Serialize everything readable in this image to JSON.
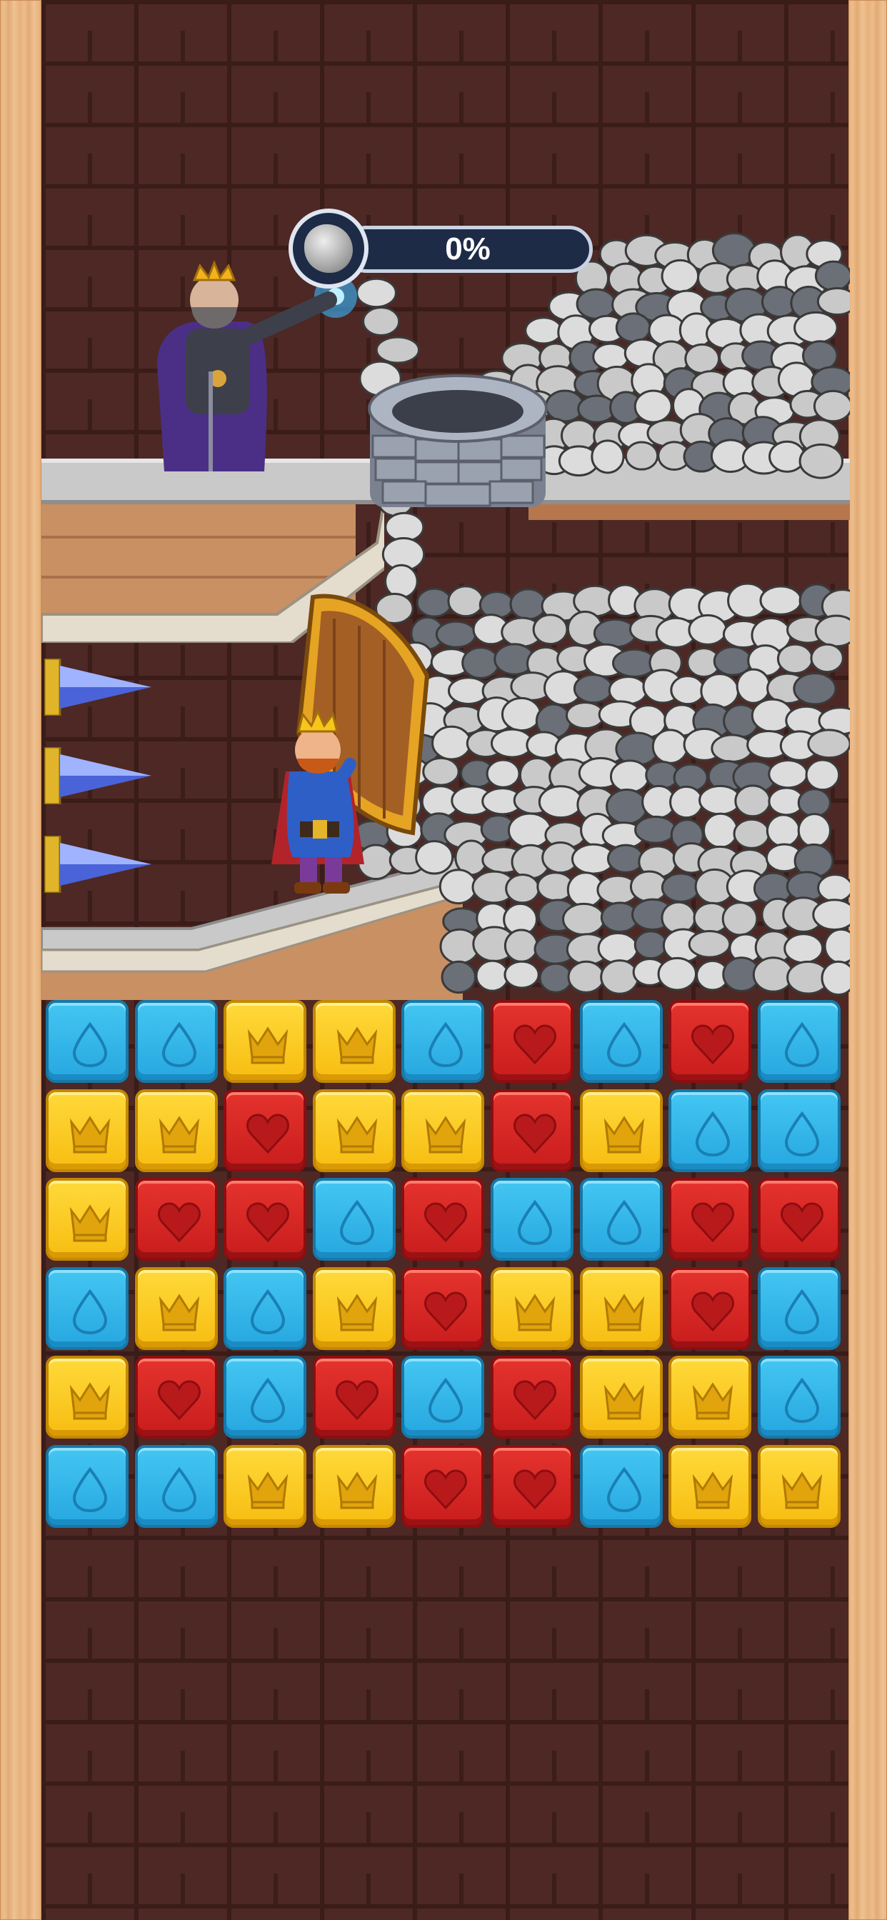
{
  "hud": {
    "progress_text": "0%",
    "progress_value": 0,
    "progress_icon": "rock-icon"
  },
  "scene": {
    "villain": "evil-king-wizard",
    "hero": "king",
    "well": "stone-well",
    "trap": "drill-spikes",
    "rocks": "rock-pile"
  },
  "colors": {
    "blue": "#2fb3e8",
    "yellow": "#f9c51a",
    "red": "#d6262a",
    "wall": "#4d2824"
  },
  "board": {
    "rows": [
      [
        "blue",
        "blue",
        "yellow",
        "yellow",
        "blue",
        "red",
        "blue",
        "red",
        "blue"
      ],
      [
        "yellow",
        "yellow",
        "red",
        "yellow",
        "yellow",
        "red",
        "yellow",
        "blue",
        "blue"
      ],
      [
        "yellow",
        "red",
        "red",
        "blue",
        "red",
        "blue",
        "blue",
        "red",
        "red"
      ],
      [
        "blue",
        "yellow",
        "blue",
        "yellow",
        "red",
        "yellow",
        "yellow",
        "red",
        "blue"
      ],
      [
        "yellow",
        "red",
        "blue",
        "red",
        "blue",
        "red",
        "yellow",
        "yellow",
        "blue"
      ],
      [
        "blue",
        "blue",
        "yellow",
        "yellow",
        "red",
        "red",
        "blue",
        "yellow",
        "yellow"
      ]
    ]
  }
}
